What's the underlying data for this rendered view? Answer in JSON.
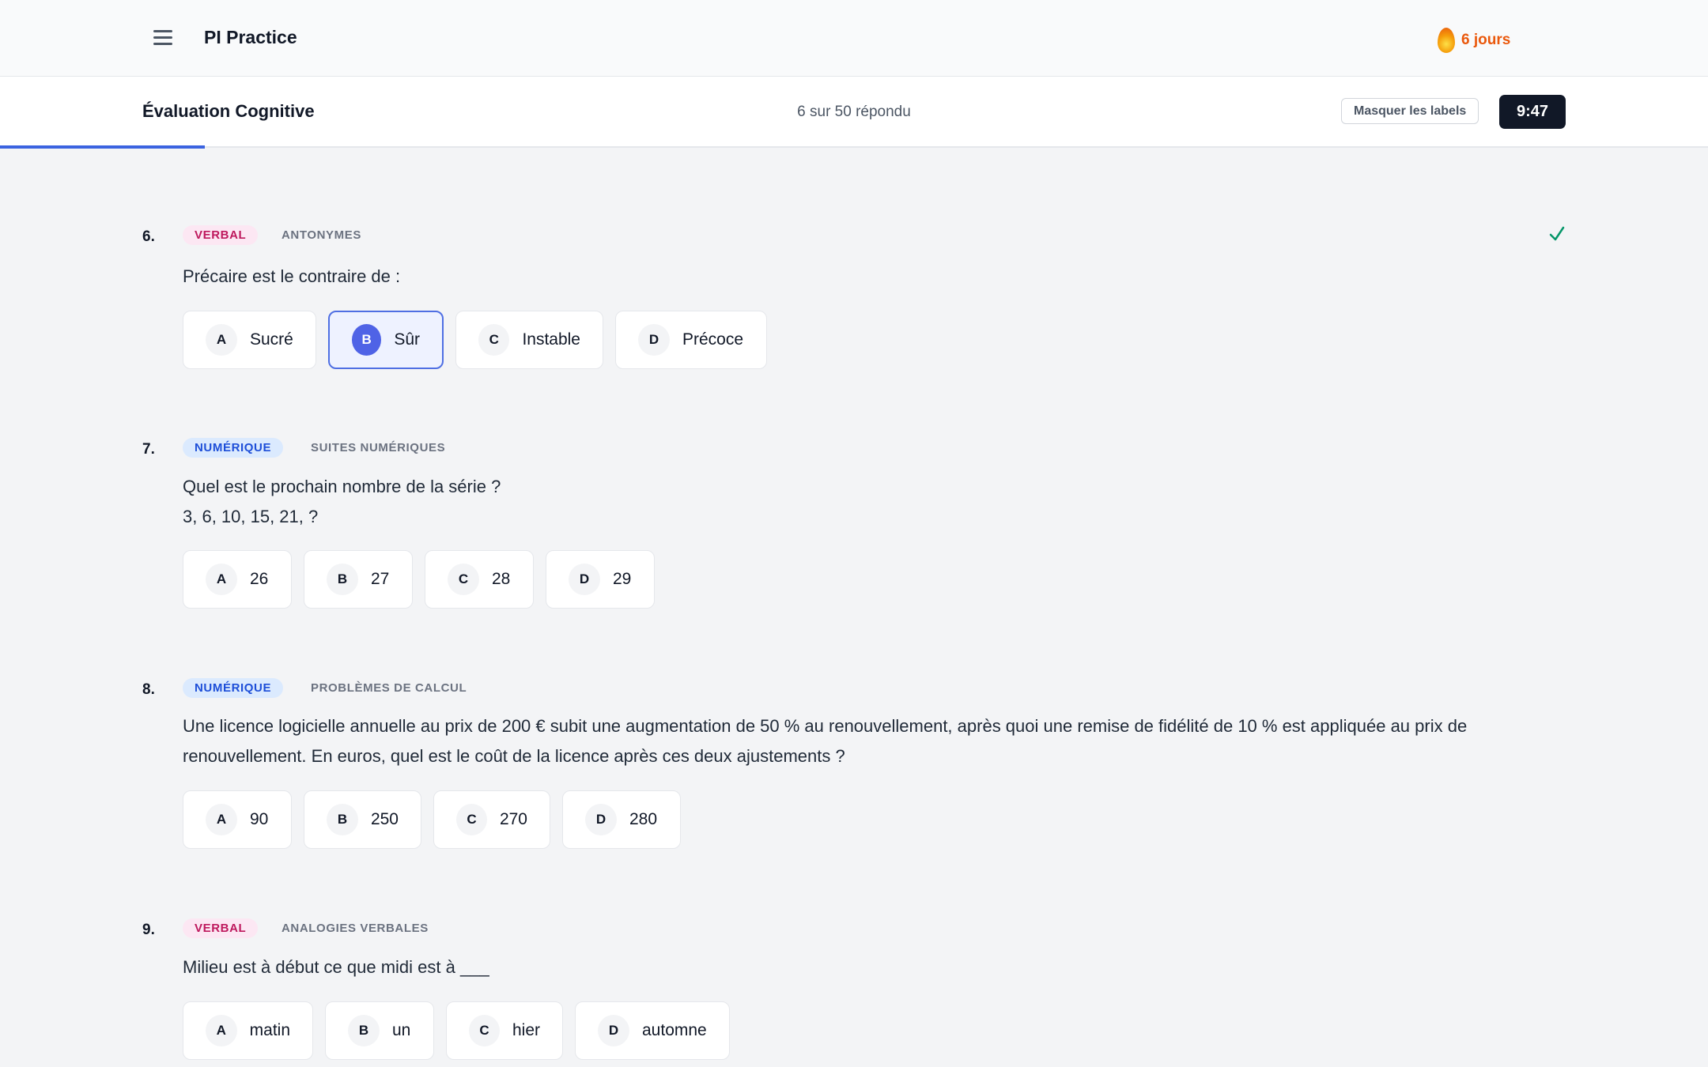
{
  "app": {
    "title": "PI Practice",
    "streak": "6 jours"
  },
  "header": {
    "title": "Évaluation Cognitive",
    "answered": "6 sur 50 répondu",
    "hide_labels": "Masquer les labels",
    "timer": "9:47",
    "progress": 0.12
  },
  "questions": [
    {
      "number": "6.",
      "category": "VERBAL",
      "subcategory": "ANTONYMES",
      "text": "Précaire est le contraire de :",
      "answered": true,
      "options": [
        {
          "letter": "A",
          "text": "Sucré"
        },
        {
          "letter": "B",
          "text": "Sûr",
          "selected": true
        },
        {
          "letter": "C",
          "text": "Instable"
        },
        {
          "letter": "D",
          "text": "Précoce"
        }
      ]
    },
    {
      "number": "7.",
      "category": "NUMÉRIQUE",
      "subcategory": "SUITES NUMÉRIQUES",
      "text": "Quel est le prochain nombre de la série ?",
      "text2": "3, 6, 10, 15, 21, ?",
      "options": [
        {
          "letter": "A",
          "text": "26"
        },
        {
          "letter": "B",
          "text": "27"
        },
        {
          "letter": "C",
          "text": "28"
        },
        {
          "letter": "D",
          "text": "29"
        }
      ]
    },
    {
      "number": "8.",
      "category": "NUMÉRIQUE",
      "subcategory": "PROBLÈMES DE CALCUL",
      "text": "Une licence logicielle annuelle au prix de 200 € subit une augmentation de 50 % au renouvellement, après quoi une remise de fidélité de 10 % est appliquée au prix de",
      "text2": "renouvellement. En euros, quel est le coût de la licence après ces deux ajustements ?",
      "options": [
        {
          "letter": "A",
          "text": "90"
        },
        {
          "letter": "B",
          "text": "250"
        },
        {
          "letter": "C",
          "text": "270"
        },
        {
          "letter": "D",
          "text": "280"
        }
      ]
    },
    {
      "number": "9.",
      "category": "VERBAL",
      "subcategory": "ANALOGIES VERBALES",
      "text": "Milieu est à début ce que midi est à ___",
      "options": [
        {
          "letter": "A",
          "text": "matin"
        },
        {
          "letter": "B",
          "text": "un"
        },
        {
          "letter": "C",
          "text": "hier"
        },
        {
          "letter": "D",
          "text": "automne"
        }
      ]
    }
  ]
}
